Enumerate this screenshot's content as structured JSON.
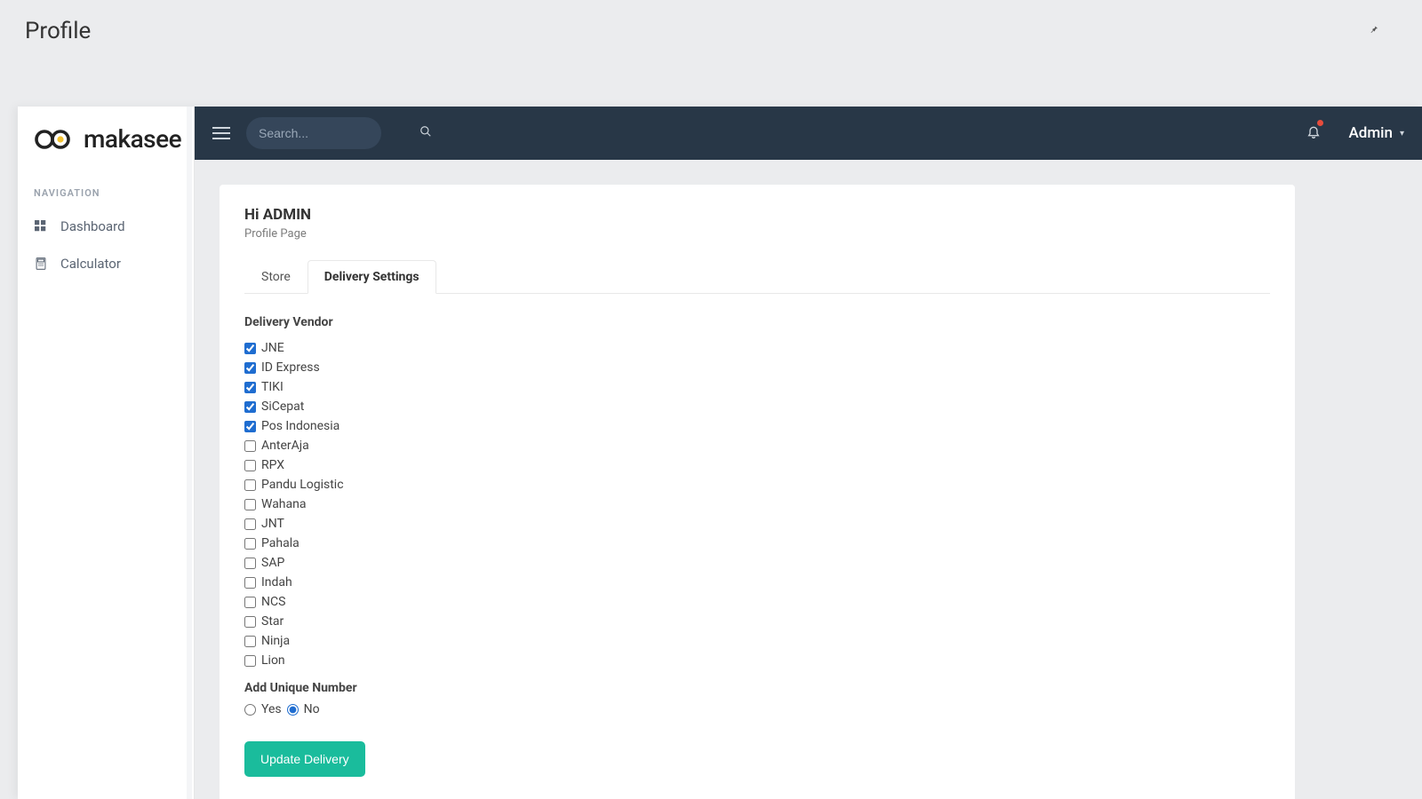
{
  "page": {
    "title": "Profile"
  },
  "brand": {
    "name": "makasee"
  },
  "sidebar": {
    "heading": "NAVIGATION",
    "items": [
      {
        "label": "Dashboard"
      },
      {
        "label": "Calculator"
      }
    ]
  },
  "topbar": {
    "search_placeholder": "Search...",
    "user_label": "Admin"
  },
  "card": {
    "title": "Hi  ADMIN",
    "subtitle": "Profile Page"
  },
  "tabs": [
    {
      "label": "Store",
      "active": false
    },
    {
      "label": "Delivery Settings",
      "active": true
    }
  ],
  "delivery": {
    "vendor_heading": "Delivery Vendor",
    "vendors": [
      {
        "label": "JNE",
        "checked": true
      },
      {
        "label": "ID Express",
        "checked": true
      },
      {
        "label": "TIKI",
        "checked": true
      },
      {
        "label": "SiCepat",
        "checked": true
      },
      {
        "label": "Pos Indonesia",
        "checked": true
      },
      {
        "label": "AnterAja",
        "checked": false
      },
      {
        "label": "RPX",
        "checked": false
      },
      {
        "label": "Pandu Logistic",
        "checked": false
      },
      {
        "label": "Wahana",
        "checked": false
      },
      {
        "label": "JNT",
        "checked": false
      },
      {
        "label": "Pahala",
        "checked": false
      },
      {
        "label": "SAP",
        "checked": false
      },
      {
        "label": "Indah",
        "checked": false
      },
      {
        "label": "NCS",
        "checked": false
      },
      {
        "label": "Star",
        "checked": false
      },
      {
        "label": "Ninja",
        "checked": false
      },
      {
        "label": "Lion",
        "checked": false
      }
    ],
    "unique_heading": "Add Unique Number",
    "unique_options": {
      "yes": "Yes",
      "no": "No",
      "selected": "no"
    },
    "submit_label": "Update Delivery"
  }
}
